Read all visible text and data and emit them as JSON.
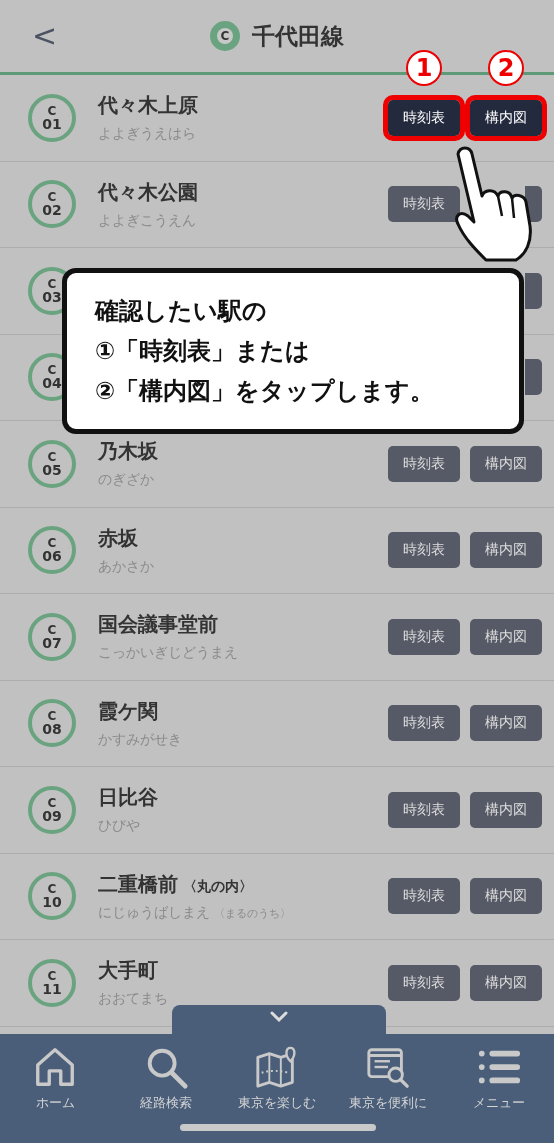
{
  "header": {
    "back": "<",
    "line_letter": "C",
    "title": "千代田線"
  },
  "stations": [
    {
      "letter": "C",
      "number": "01",
      "name": "代々木上原",
      "reading": "よよぎうえはら",
      "buttons": [
        {
          "label": "時刻表",
          "highlighted": true,
          "step": "1"
        },
        {
          "label": "構内図",
          "highlighted": true,
          "step": "2"
        }
      ]
    },
    {
      "letter": "C",
      "number": "02",
      "name": "代々木公園",
      "reading": "よよぎこうえん",
      "buttons": [
        {
          "label": "時刻表",
          "highlighted": false
        },
        {
          "kind": "covered"
        }
      ]
    },
    {
      "letter": "C",
      "number": "03",
      "buttons": [
        {
          "kind": "hidden"
        },
        {
          "kind": "covered"
        }
      ]
    },
    {
      "letter": "C",
      "number": "04",
      "buttons": [
        {
          "kind": "hidden"
        },
        {
          "kind": "covered"
        }
      ]
    },
    {
      "letter": "C",
      "number": "05",
      "name": "乃木坂",
      "reading": "のぎざか",
      "buttons": [
        {
          "label": "時刻表",
          "highlighted": false
        },
        {
          "label": "構内図",
          "highlighted": false
        }
      ]
    },
    {
      "letter": "C",
      "number": "06",
      "name": "赤坂",
      "reading": "あかさか",
      "buttons": [
        {
          "label": "時刻表",
          "highlighted": false
        },
        {
          "label": "構内図",
          "highlighted": false
        }
      ]
    },
    {
      "letter": "C",
      "number": "07",
      "name": "国会議事堂前",
      "reading": "こっかいぎじどうまえ",
      "buttons": [
        {
          "label": "時刻表",
          "highlighted": false
        },
        {
          "label": "構内図",
          "highlighted": false
        }
      ]
    },
    {
      "letter": "C",
      "number": "08",
      "name": "霞ケ関",
      "reading": "かすみがせき",
      "buttons": [
        {
          "label": "時刻表",
          "highlighted": false
        },
        {
          "label": "構内図",
          "highlighted": false
        }
      ]
    },
    {
      "letter": "C",
      "number": "09",
      "name": "日比谷",
      "reading": "ひびや",
      "buttons": [
        {
          "label": "時刻表",
          "highlighted": false
        },
        {
          "label": "構内図",
          "highlighted": false
        }
      ]
    },
    {
      "letter": "C",
      "number": "10",
      "name": "二重橋前",
      "name_note": "〈丸の内〉",
      "reading": "にじゅうばしまえ",
      "reading_note": "〈まるのうち〉",
      "buttons": [
        {
          "label": "時刻表",
          "highlighted": false
        },
        {
          "label": "構内図",
          "highlighted": false
        }
      ]
    },
    {
      "letter": "C",
      "number": "11",
      "name": "大手町",
      "reading": "おおてまち",
      "buttons": [
        {
          "label": "時刻表",
          "highlighted": false
        },
        {
          "label": "構内図",
          "highlighted": false
        }
      ]
    }
  ],
  "callout": {
    "lines": [
      "確認したい駅の",
      "①「時刻表」または",
      "②「構内図」をタップします。"
    ]
  },
  "nav": [
    {
      "kind": "home",
      "label": "ホーム"
    },
    {
      "kind": "search",
      "label": "経路検索"
    },
    {
      "kind": "map",
      "label": "東京を楽しむ"
    },
    {
      "kind": "info",
      "label": "東京を便利に"
    },
    {
      "kind": "menu",
      "label": "メニュー"
    }
  ]
}
